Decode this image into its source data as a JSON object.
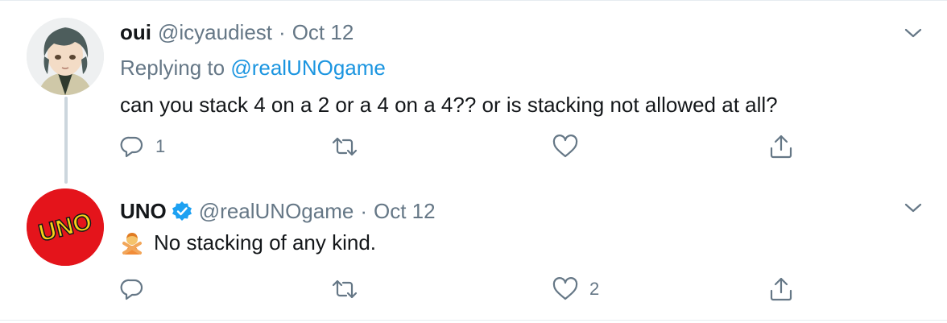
{
  "tweets": [
    {
      "name": "oui",
      "handle": "@icyaudiest",
      "separator": "·",
      "time": "Oct 12",
      "verified": false,
      "replying_prefix": "Replying to",
      "replying_handle": "@realUNOgame",
      "text": "can you stack 4 on a 2 or a 4 on a 4?? or is stacking not allowed at all?",
      "reply_count": "1",
      "retweet_count": "",
      "like_count": "",
      "avatar_icon": "anime-character-avatar"
    },
    {
      "name": "UNO",
      "handle": "@realUNOgame",
      "separator": "·",
      "time": "Oct 12",
      "verified": true,
      "text": "No stacking of any kind.",
      "emoji_icon": "person-gesturing-no-emoji",
      "reply_count": "",
      "retweet_count": "",
      "like_count": "2",
      "avatar_icon": "uno-logo",
      "avatar_logo_text": "UNO"
    }
  ],
  "colors": {
    "text_primary": "#14171a",
    "text_secondary": "#657786",
    "link": "#1b95e0",
    "verified": "#1da1f2",
    "divider": "#e6ecf0",
    "thread_line": "#ccd6dd",
    "uno_red": "#e4141b",
    "uno_yellow": "#f7d117"
  }
}
